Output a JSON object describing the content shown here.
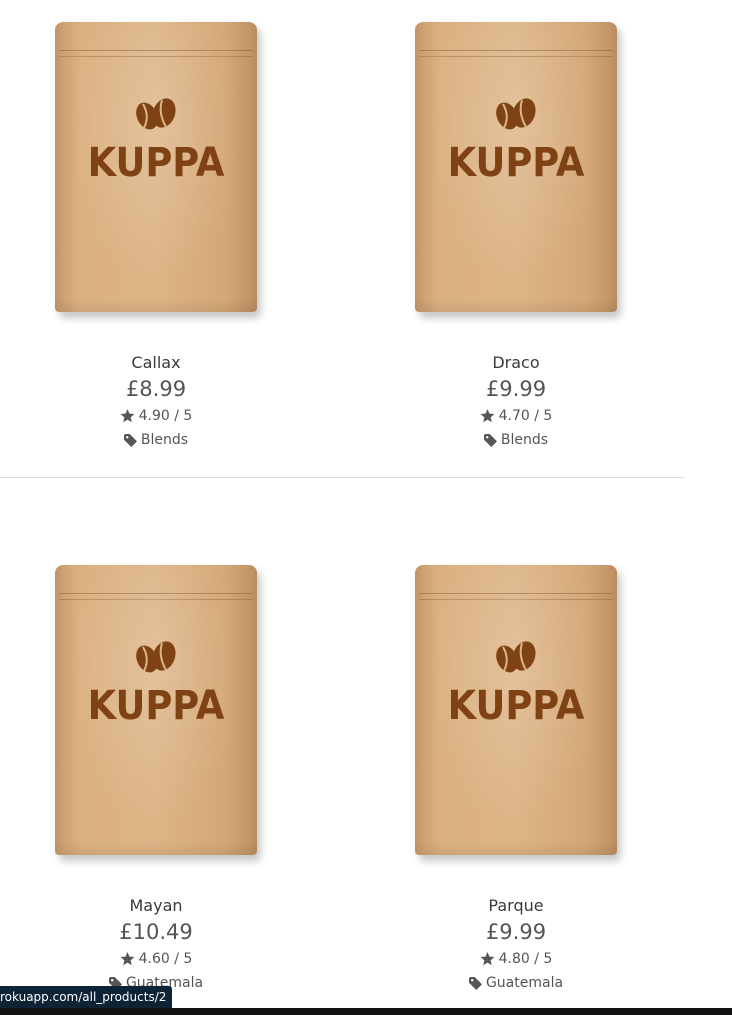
{
  "products": [
    {
      "brand": "KUPPA",
      "name": "Callax",
      "price": "£8.99",
      "rating": "4.90 / 5",
      "category": "Blends"
    },
    {
      "brand": "KUPPA",
      "name": "Draco",
      "price": "£9.99",
      "rating": "4.70 / 5",
      "category": "Blends"
    },
    {
      "brand": "KUPPA",
      "name": "Mayan",
      "price": "£10.49",
      "rating": "4.60 / 5",
      "category": "Guatemala"
    },
    {
      "brand": "KUPPA",
      "name": "Parque",
      "price": "£9.99",
      "rating": "4.80 / 5",
      "category": "Guatemala"
    }
  ],
  "status_bar": {
    "url": "rokuapp.com/all_products/2"
  },
  "icons": {
    "rating": "star-icon",
    "category": "tag-icon",
    "logo": "coffee-bean-icon"
  },
  "colors": {
    "brand_text": "#7f4214",
    "pouch": "#ddb486",
    "status_bg": "#0f2336"
  }
}
